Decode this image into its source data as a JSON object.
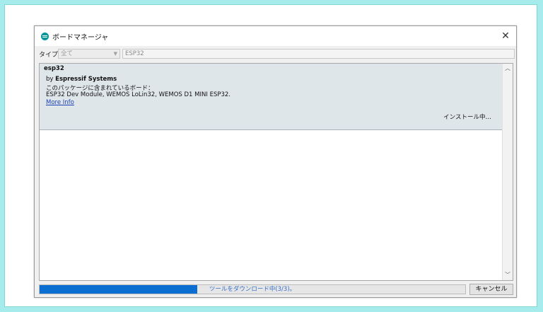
{
  "window": {
    "title": "ボードマネージャ"
  },
  "filter": {
    "type_label": "タイプ",
    "type_selected": "全て",
    "search_value": "ESP32"
  },
  "entry": {
    "name": "esp32",
    "by_prefix": "by",
    "author": "Espressif Systems",
    "boards_label": "このパッケージに含まれているボード：",
    "boards": "ESP32 Dev Module, WEMOS LoLin32, WEMOS D1 MINI ESP32.",
    "more_info": "More Info",
    "status": "インストール中…"
  },
  "progress": {
    "text": "ツールをダウンロード中(3/3)。",
    "fraction": 0.37
  },
  "cancel_label": "キャンセル",
  "colors": {
    "background": "#a7ecec",
    "progress": "#0a6fd1",
    "link": "#1a3fb5"
  }
}
